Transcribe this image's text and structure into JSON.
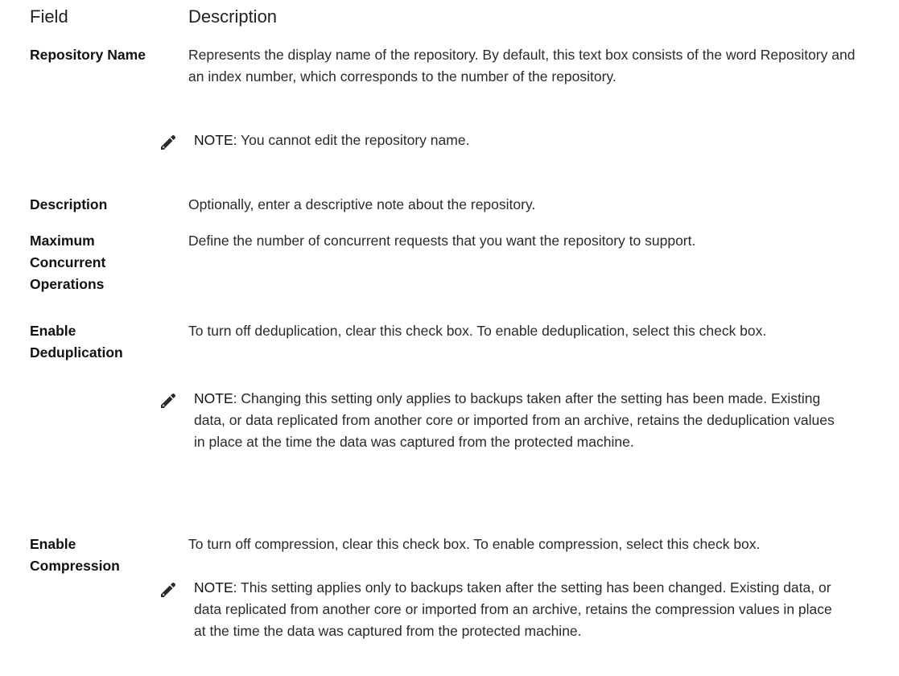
{
  "headers": {
    "field": "Field",
    "description": "Description"
  },
  "rows": [
    {
      "field_lines": [
        "Repository Name"
      ],
      "description": "Represents the display name of the repository. By default, this text box consists of the word Repository and an index number, which corresponds to the number of the repository.",
      "note": {
        "label": "NOTE:",
        "text": " You cannot edit the repository name."
      }
    },
    {
      "field_lines": [
        "Description"
      ],
      "description": "Optionally, enter a descriptive note about the repository."
    },
    {
      "field_lines": [
        "Maximum",
        "Concurrent",
        "Operations"
      ],
      "description": "Define the number of concurrent requests that you want the repository to support."
    },
    {
      "field_lines": [
        "Enable",
        "Deduplication"
      ],
      "description": "To turn off deduplication, clear this check box. To enable deduplication, select this check box.",
      "note": {
        "label": "NOTE:",
        "text": " Changing this setting only applies to backups taken after the setting has been made. Existing data, or data replicated from another core or imported from an archive, retains the deduplication values in place at the time the data was captured from the protected machine."
      }
    },
    {
      "field_lines": [
        "Enable",
        "Compression"
      ],
      "description": "To turn off compression, clear this check box. To enable compression, select this check box.",
      "note": {
        "label": "NOTE:",
        "text": " This setting applies only to backups taken after the setting has been changed. Existing data, or data replicated from another core or imported from an archive, retains the compression values in place at the time the data was captured from the protected machine."
      }
    }
  ],
  "note_icon": "pencil-note-icon"
}
